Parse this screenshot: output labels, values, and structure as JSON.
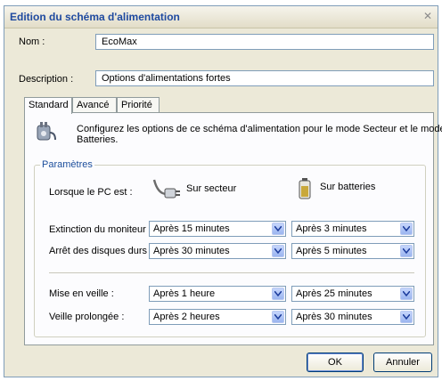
{
  "window": {
    "title": "Edition du schéma d'alimentation"
  },
  "fields": {
    "nom_label": "Nom :",
    "nom_value": "EcoMax",
    "description_label": "Description :",
    "description_value": "Options d'alimentations fortes"
  },
  "tabs": [
    {
      "label": "Standard",
      "active": true
    },
    {
      "label": "Avancé",
      "active": false
    },
    {
      "label": "Priorité",
      "active": false
    }
  ],
  "info_text_line1": "Configurez les options de ce schéma d'alimentation pour le mode Secteur et le mode",
  "info_text_line2": "Batteries.",
  "group": {
    "legend": "Paramètres",
    "pc_state_label": "Lorsque le PC est :",
    "ac_label": "Sur secteur",
    "battery_label": "Sur batteries",
    "rows": [
      {
        "label": "Extinction du moniteur :",
        "ac": "Après 15 minutes",
        "battery": "Après 3 minutes"
      },
      {
        "label": "Arrêt des disques durs :",
        "ac": "Après 30 minutes",
        "battery": "Après 5 minutes"
      },
      {
        "label": "Mise en veille :",
        "ac": "Après 1 heure",
        "battery": "Après 25 minutes"
      },
      {
        "label": "Veille prolongée :",
        "ac": "Après 2 heures",
        "battery": "Après 30 minutes"
      }
    ]
  },
  "buttons": {
    "ok": "OK",
    "cancel": "Annuler"
  },
  "icons": [
    "close-icon",
    "power-plug-icon",
    "ac-plug-icon",
    "battery-icon",
    "chevron-down-icon"
  ]
}
